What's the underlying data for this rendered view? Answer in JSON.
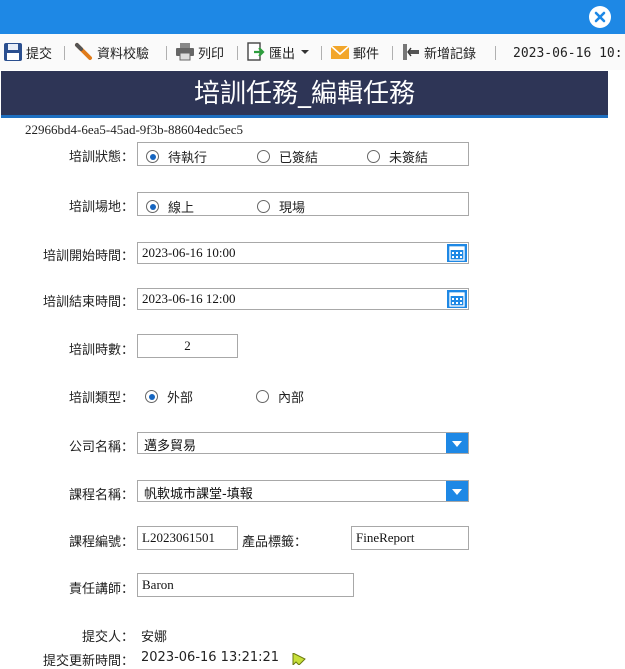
{
  "toolbar": {
    "submit": "提交",
    "validate": "資料校驗",
    "print": "列印",
    "export": "匯出",
    "mail": "郵件",
    "add_record": "新增記錄",
    "datetime": "2023-06-16 10:"
  },
  "page_title": "培訓任務_編輯任務",
  "record_id": "22966bd4-6ea5-45ad-9f3b-88604edc5ec5",
  "form": {
    "status": {
      "label": "培訓狀態：",
      "options": [
        "待執行",
        "已簽結",
        "未簽結"
      ],
      "selected": "待執行"
    },
    "venue": {
      "label": "培訓場地：",
      "options": [
        "線上",
        "現場"
      ],
      "selected": "線上"
    },
    "start_time": {
      "label": "培訓開始時間：",
      "value": "2023-06-16 10:00"
    },
    "end_time": {
      "label": "培訓結束時間：",
      "value": "2023-06-16 12:00"
    },
    "hours": {
      "label": "培訓時數：",
      "value": "2"
    },
    "type": {
      "label": "培訓類型：",
      "options": [
        "外部",
        "內部"
      ],
      "selected": "外部"
    },
    "company": {
      "label": "公司名稱：",
      "value": "邁多貿易"
    },
    "course_name": {
      "label": "課程名稱：",
      "value": "帆軟城市課堂-填報"
    },
    "course_code": {
      "label": "課程編號：",
      "value": "L2023061501"
    },
    "product_tag": {
      "label": "產品標籤：",
      "value": "FineReport"
    },
    "instructor": {
      "label": "責任講師：",
      "value": "Baron"
    },
    "submitter": {
      "label": "提交人：",
      "value": "安娜"
    },
    "updated_at": {
      "label": "提交更新時間：",
      "value": "2023-06-16 13:21:21"
    }
  },
  "colors": {
    "titlebar": "#1e88e5",
    "banner": "#2e3556",
    "accent": "#1e88e5"
  },
  "icons": [
    "close-icon",
    "save-icon",
    "validate-icon",
    "print-icon",
    "export-icon",
    "mail-icon",
    "add-record-icon",
    "calendar-icon",
    "dropdown-arrow-icon",
    "cursor-icon"
  ]
}
